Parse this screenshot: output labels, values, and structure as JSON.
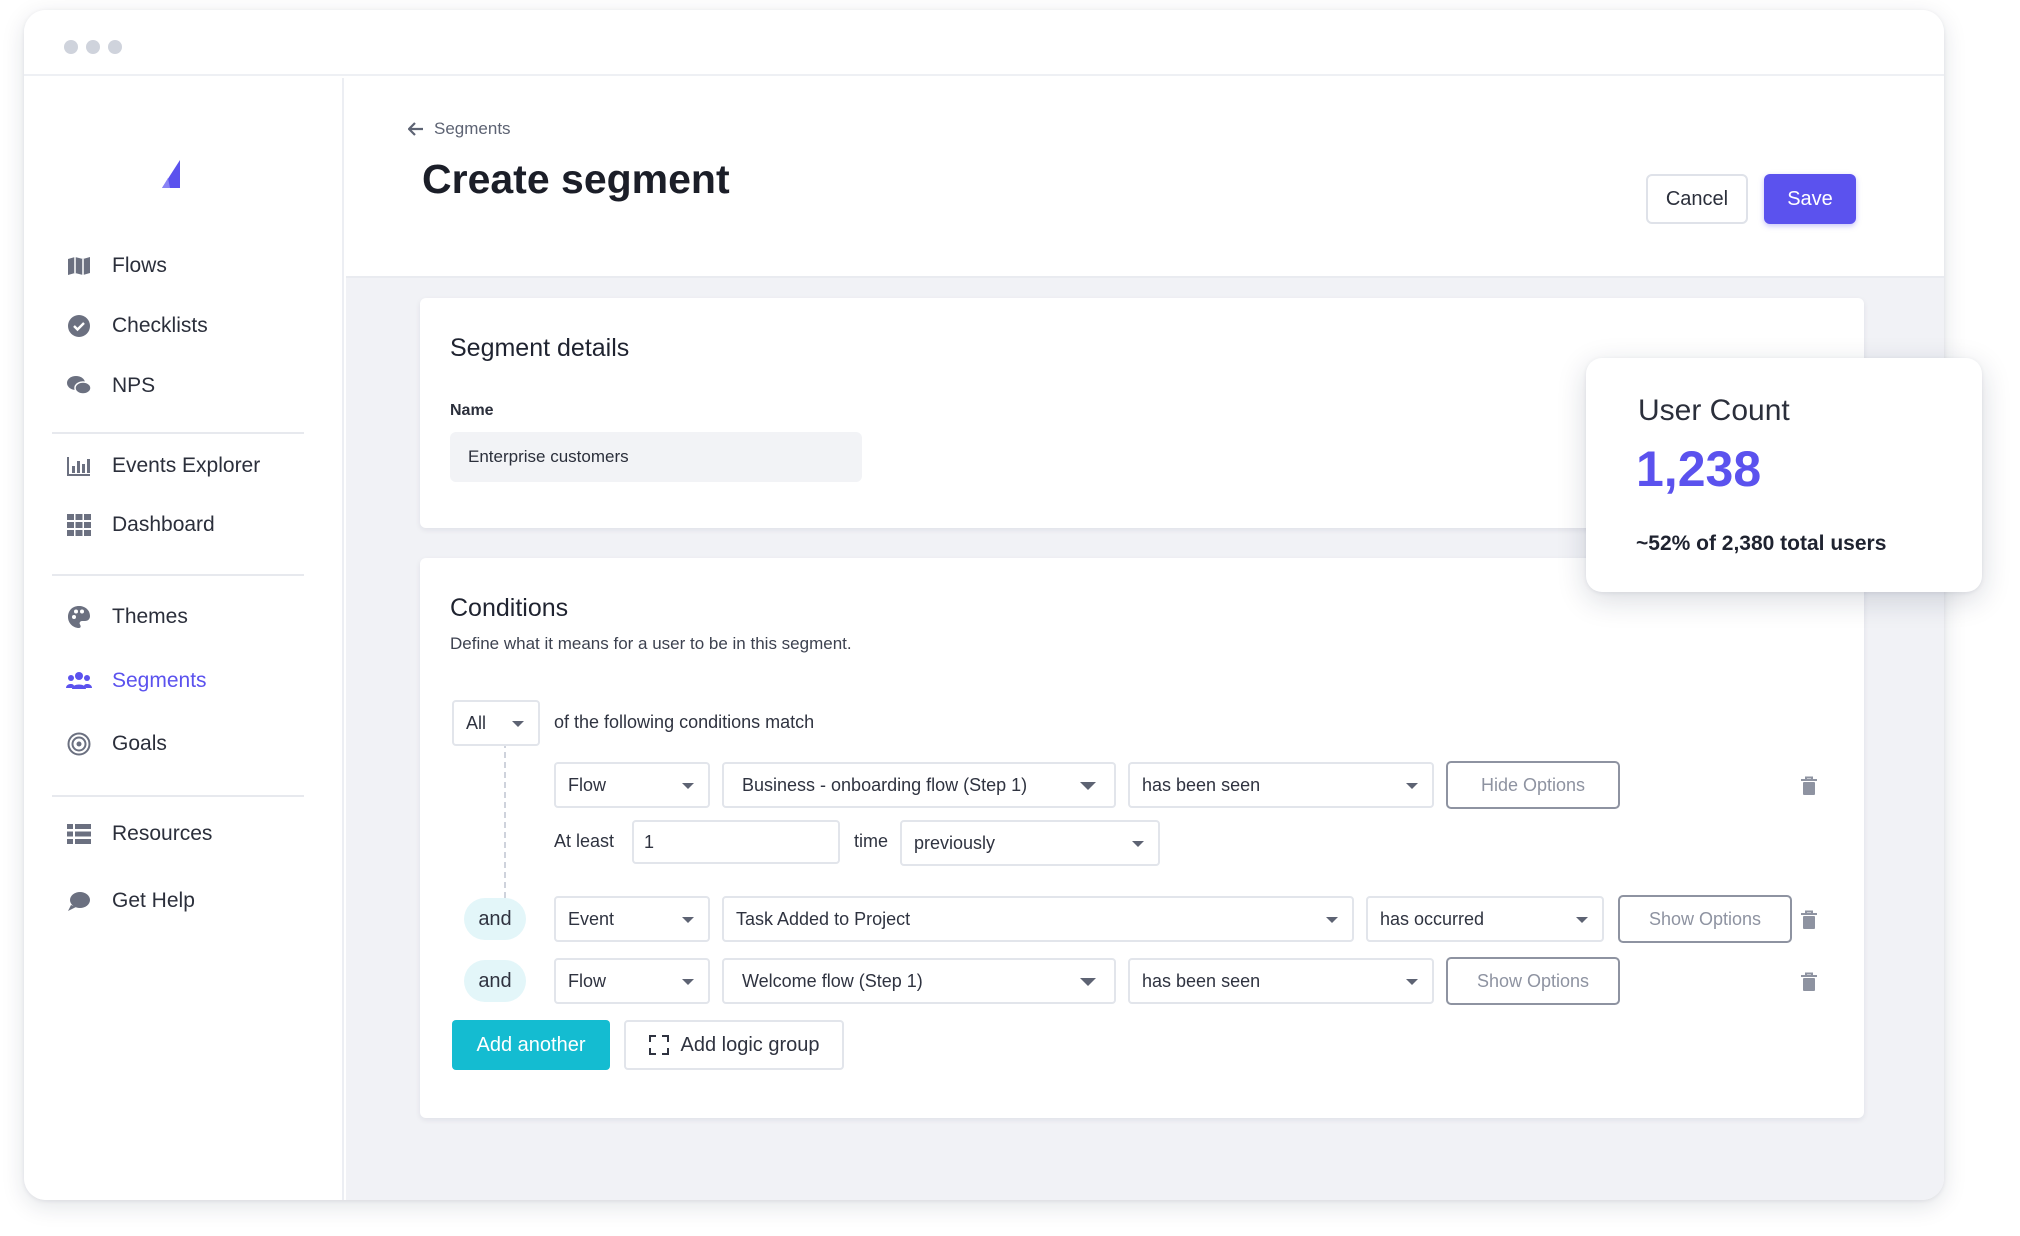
{
  "sidebar": {
    "items": [
      {
        "label": "Flows",
        "icon": "map-icon"
      },
      {
        "label": "Checklists",
        "icon": "check-circle-icon"
      },
      {
        "label": "NPS",
        "icon": "chat-bubbles-icon"
      },
      {
        "label": "Events Explorer",
        "icon": "bar-chart-icon"
      },
      {
        "label": "Dashboard",
        "icon": "grid-icon"
      },
      {
        "label": "Themes",
        "icon": "palette-icon"
      },
      {
        "label": "Segments",
        "icon": "users-icon",
        "active": true
      },
      {
        "label": "Goals",
        "icon": "target-icon"
      },
      {
        "label": "Resources",
        "icon": "list-icon"
      },
      {
        "label": "Get Help",
        "icon": "speech-bubble-icon"
      }
    ]
  },
  "header": {
    "breadcrumb": "Segments",
    "title": "Create segment",
    "cancel_label": "Cancel",
    "save_label": "Save"
  },
  "details": {
    "title": "Segment details",
    "name_label": "Name",
    "name_value": "Enterprise customers"
  },
  "conditions": {
    "title": "Conditions",
    "subtitle": "Define what it means for a user to be in this segment.",
    "match_value": "All",
    "match_text": "of the following conditions match",
    "rows": [
      {
        "type": "Flow",
        "target": "Business - onboarding flow (Step 1)",
        "operator": "has been seen",
        "options_label": "Hide Options"
      },
      {
        "connector": "and",
        "type": "Event",
        "target": "Task Added to Project",
        "operator": "has occurred",
        "options_label": "Show Options"
      },
      {
        "connector": "and",
        "type": "Flow",
        "target": "Welcome flow (Step 1)",
        "operator": "has been seen",
        "options_label": "Show Options"
      }
    ],
    "frequency": {
      "prefix": "At least",
      "count": "1",
      "unit": "time",
      "timeframe": "previously"
    },
    "add_another_label": "Add another",
    "add_group_label": "Add logic group"
  },
  "user_count": {
    "title": "User Count",
    "value": "1,238",
    "subtitle": "~52% of 2,380 total users"
  },
  "colors": {
    "accent": "#5b52ee",
    "teal": "#14bcd1"
  }
}
